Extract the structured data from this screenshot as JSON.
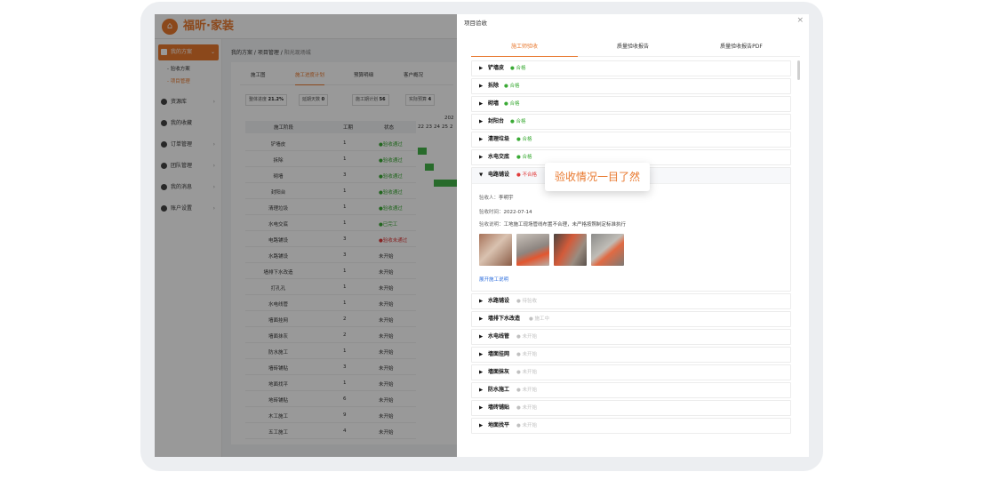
{
  "brand": {
    "name": "福昕·家装",
    "logo_char": "⌂"
  },
  "sidebar": {
    "items": [
      {
        "label": "我的方案",
        "active": true
      },
      {
        "label": "资源库"
      },
      {
        "label": "我的收藏"
      },
      {
        "label": "订单管理"
      },
      {
        "label": "团队管理"
      },
      {
        "label": "我的消息"
      },
      {
        "label": "账户设置"
      }
    ],
    "sub_items": [
      {
        "label": "- 验收方案"
      },
      {
        "label": "- 项目管理",
        "active": true
      }
    ]
  },
  "breadcrumb": {
    "a": "我的方案",
    "sep": " / ",
    "b": "项目管理",
    "c": "阳光现场城"
  },
  "left_tabs": [
    "施工图",
    "施工进度计划",
    "预算明细",
    "客户概况"
  ],
  "stats": [
    {
      "label": "整体进度",
      "value": "21.2%"
    },
    {
      "label": "延期天数",
      "value": "0"
    },
    {
      "label": "施工期计划",
      "value": "56"
    },
    {
      "label": "实际预算",
      "value": "4"
    }
  ],
  "table": {
    "headers": [
      "施工阶段",
      "工期",
      "状态"
    ],
    "gantt_year": "202",
    "gantt_days": [
      "22",
      "23",
      "24",
      "25",
      "2"
    ],
    "rows": [
      {
        "name": "铲墙皮",
        "days": "1",
        "status": "●验收通过",
        "kind": "ok"
      },
      {
        "name": "拆除",
        "days": "1",
        "status": "●验收通过",
        "kind": "ok"
      },
      {
        "name": "砌墙",
        "days": "3",
        "status": "●验收通过",
        "kind": "ok"
      },
      {
        "name": "封阳台",
        "days": "1",
        "status": "●验收通过",
        "kind": "ok"
      },
      {
        "name": "清理垃圾",
        "days": "1",
        "status": "●验收通过",
        "kind": "ok"
      },
      {
        "name": "水电交底",
        "days": "1",
        "status": "●已完工",
        "kind": "ok"
      },
      {
        "name": "电路铺设",
        "days": "3",
        "status": "●验收未通过",
        "kind": "bad"
      },
      {
        "name": "水路铺设",
        "days": "3",
        "status": "未开始",
        "kind": "gray"
      },
      {
        "name": "墙排下水改造",
        "days": "1",
        "status": "未开始",
        "kind": "gray"
      },
      {
        "name": "打孔孔",
        "days": "1",
        "status": "未开始",
        "kind": "gray"
      },
      {
        "name": "水电线管",
        "days": "1",
        "status": "未开始",
        "kind": "gray"
      },
      {
        "name": "墙面挂网",
        "days": "2",
        "status": "未开始",
        "kind": "gray"
      },
      {
        "name": "墙面抹灰",
        "days": "2",
        "status": "未开始",
        "kind": "gray"
      },
      {
        "name": "防水施工",
        "days": "1",
        "status": "未开始",
        "kind": "gray"
      },
      {
        "name": "墙砖铺贴",
        "days": "3",
        "status": "未开始",
        "kind": "gray"
      },
      {
        "name": "地面找平",
        "days": "1",
        "status": "未开始",
        "kind": "gray"
      },
      {
        "name": "地砖铺贴",
        "days": "6",
        "status": "未开始",
        "kind": "gray"
      },
      {
        "name": "木工施工",
        "days": "9",
        "status": "未开始",
        "kind": "gray"
      },
      {
        "name": "五工施工",
        "days": "4",
        "status": "未开始",
        "kind": "gray"
      }
    ]
  },
  "drawer": {
    "title": "项目验收",
    "close": "×",
    "tabs": [
      "施工师验收",
      "质量验收报告",
      "质量验收报告PDF"
    ],
    "items": [
      {
        "name": "铲墙皮",
        "badge": "● 合格",
        "kind": "ok"
      },
      {
        "name": "拆除",
        "badge": "● 合格",
        "kind": "ok"
      },
      {
        "name": "砌墙",
        "badge": "● 合格",
        "kind": "ok"
      },
      {
        "name": "封阳台",
        "badge": "● 合格",
        "kind": "ok"
      },
      {
        "name": "清理垃圾",
        "badge": "● 合格",
        "kind": "ok"
      },
      {
        "name": "水电交底",
        "badge": "● 合格",
        "kind": "ok"
      }
    ],
    "open_item": {
      "name": "电路铺设",
      "badge": "● 不合格",
      "inspector_label": "验收人：",
      "inspector": "李明宇",
      "time_label": "验收时间：",
      "time": "2022-07-14",
      "note_label": "验收说明：",
      "note": "工地施工现场管线布置不合理，未严格按照制定标准执行",
      "link": "展开施工说明"
    },
    "rest_items": [
      {
        "name": "水路铺设",
        "badge": "● 待验收",
        "kind": "gray"
      },
      {
        "name": "墙排下水改造",
        "badge": "● 施工中",
        "kind": "gray"
      },
      {
        "name": "水电线管",
        "badge": "● 未开始",
        "kind": "gray"
      },
      {
        "name": "墙面挂网",
        "badge": "● 未开始",
        "kind": "gray"
      },
      {
        "name": "墙面抹灰",
        "badge": "● 未开始",
        "kind": "gray"
      },
      {
        "name": "防水施工",
        "badge": "● 未开始",
        "kind": "gray"
      },
      {
        "name": "墙砖铺贴",
        "badge": "● 未开始",
        "kind": "gray"
      },
      {
        "name": "地面找平",
        "badge": "● 未开始",
        "kind": "gray"
      }
    ]
  },
  "callout": {
    "text": "验收情况一目了然"
  },
  "colors": {
    "accent": "#e8782e",
    "ok": "#3aaa35",
    "bad": "#e03b3b",
    "link": "#2f6fdd"
  }
}
